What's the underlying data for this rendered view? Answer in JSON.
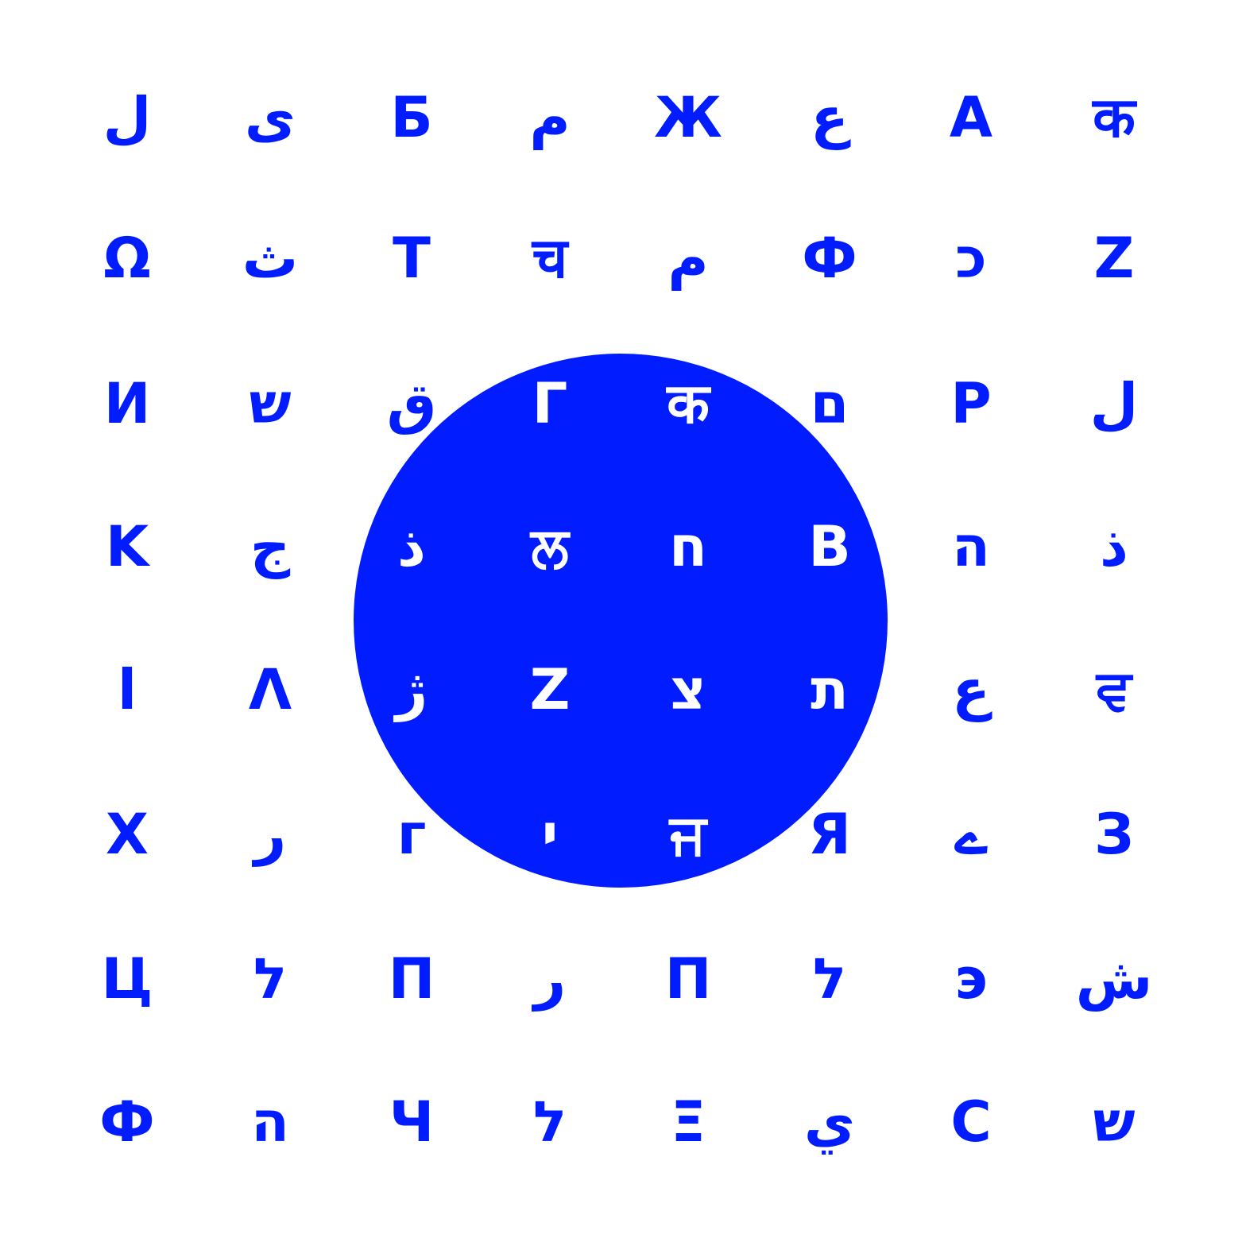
{
  "colors": {
    "background": "#ffffff",
    "accent": "#001cff",
    "on_accent": "#ffffff"
  },
  "grid": {
    "rows": [
      [
        "ل",
        "ى",
        "Б",
        "م",
        "Ж",
        "ع",
        "A",
        "क"
      ],
      [
        "Ω",
        "ث",
        "T",
        "च",
        "م",
        "Ф",
        "כ",
        "Z"
      ],
      [
        "И",
        "ש",
        "ق",
        "Γ",
        "क",
        "ם",
        "P",
        "ل"
      ],
      [
        "K",
        "ج",
        "ذ",
        "ਲ",
        "ח",
        "B",
        "ה",
        "ذ"
      ],
      [
        "ا",
        "Λ",
        "ژ",
        "Z",
        "צ",
        "ת",
        "ع",
        "ਵ"
      ],
      [
        "X",
        "ر",
        "г",
        "י",
        "ਜ",
        "Я",
        "ے",
        "З"
      ],
      [
        "Ц",
        "ל",
        "П",
        "ر",
        "П",
        "ל",
        "э",
        "ش"
      ],
      [
        "Ф",
        "ה",
        "Ч",
        "ל",
        "Ξ",
        "ي",
        "C",
        "ש"
      ]
    ]
  }
}
